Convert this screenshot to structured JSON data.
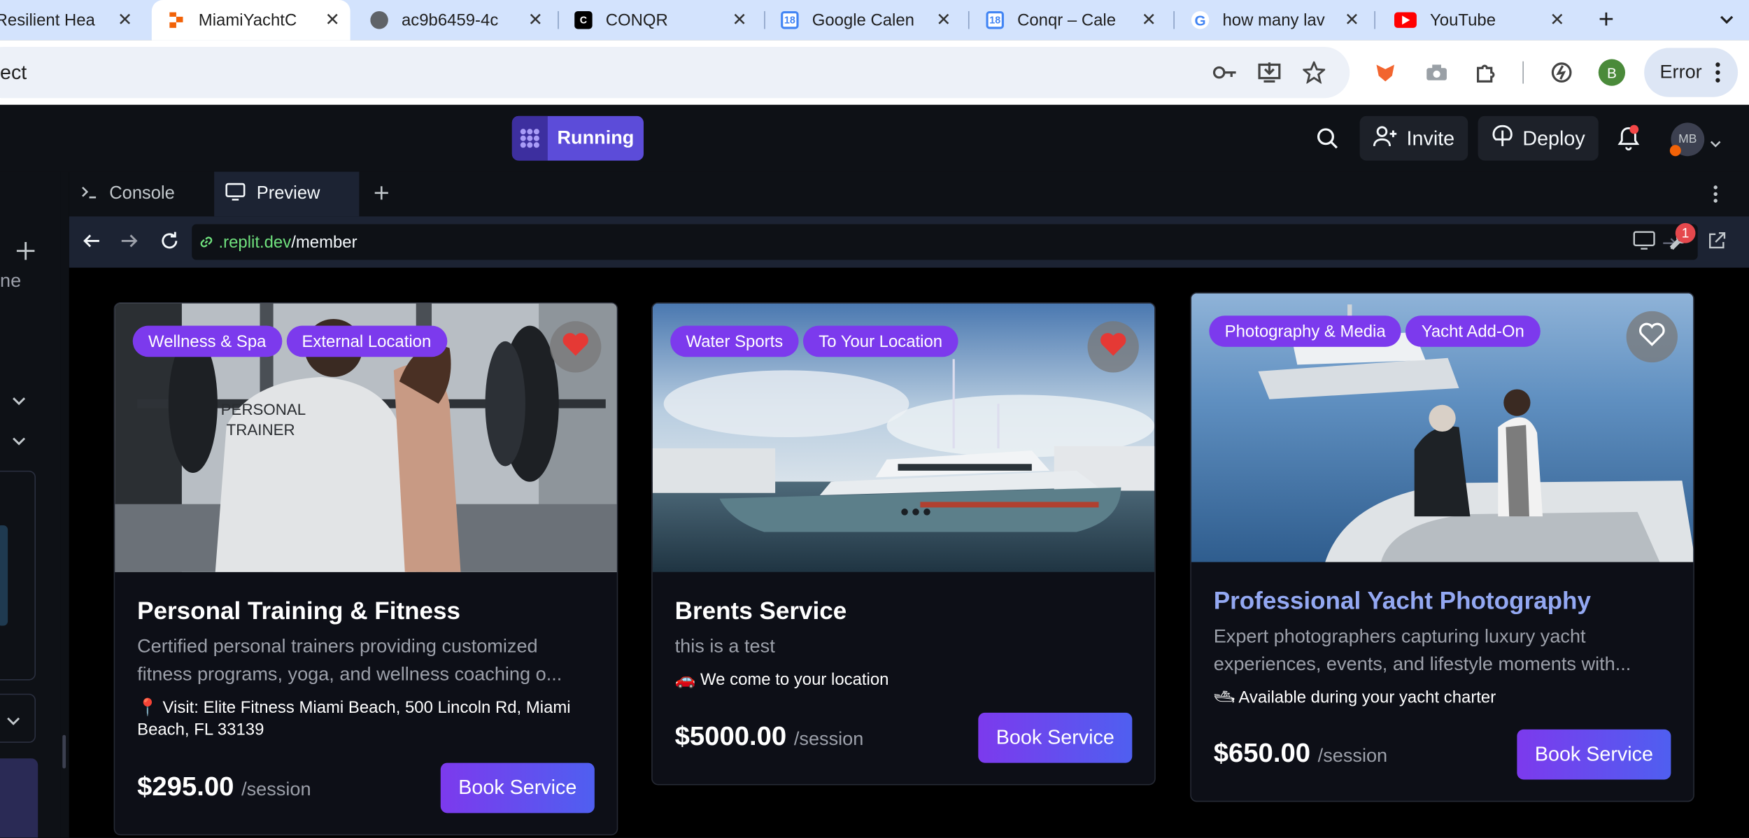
{
  "browser": {
    "tabs": [
      {
        "title": "Resilient Hea",
        "favicon_color": "#c7d3e8"
      },
      {
        "title": "MiamiYachtC",
        "favicon_color": "#f26207"
      },
      {
        "title": "ac9b6459-4c",
        "favicon_color": "#5f6368"
      },
      {
        "title": "CONQR",
        "favicon_color": "#000000",
        "favicon_text": "C"
      },
      {
        "title": "Google Calen",
        "favicon_color": "#4285f4",
        "favicon_text": "18"
      },
      {
        "title": "Conqr – Cale",
        "favicon_color": "#4285f4",
        "favicon_text": "18"
      },
      {
        "title": "how many lav",
        "favicon_color": "#ffffff",
        "favicon_text": "G"
      },
      {
        "title": "YouTube",
        "favicon_color": "#ff0000"
      }
    ],
    "close_glyph": "✕",
    "new_tab_glyph": "+",
    "address_text": "ect",
    "error_label": "Error",
    "profile_initial": "B"
  },
  "replit": {
    "run_label": "Running",
    "invite_label": "Invite",
    "deploy_label": "Deploy",
    "avatar_initials": "MB",
    "panel_tabs": [
      {
        "label": "Console",
        "icon": "terminal-icon"
      },
      {
        "label": "Preview",
        "icon": "monitor-icon"
      }
    ],
    "url_host": ".replit.dev",
    "url_path": "/member",
    "devtools_badge": "1",
    "sidebar_partial_text": "ne"
  },
  "cards": [
    {
      "badges": [
        "Wellness & Spa",
        "External Location"
      ],
      "favorited": true,
      "title": "Personal Training & Fitness",
      "description": "Certified personal trainers providing customized fitness programs, yoga, and wellness coaching o...",
      "location": "📍 Visit: Elite Fitness Miami Beach, 500 Lincoln Rd, Miami Beach, FL 33139",
      "price": "$295.00",
      "unit": "/session",
      "button": "Book Service",
      "image_text": [
        "PERSONAL",
        "TRAINER"
      ]
    },
    {
      "badges": [
        "Water Sports",
        "To Your Location"
      ],
      "favorited": true,
      "title": "Brents Service",
      "description": "this is a test",
      "location": "🚗 We come to your location",
      "price": "$5000.00",
      "unit": "/session",
      "button": "Book Service"
    },
    {
      "badges": [
        "Photography & Media",
        "Yacht Add-On"
      ],
      "favorited": false,
      "title": "Professional Yacht Photography",
      "description": "Expert photographers capturing luxury yacht experiences, events, and lifestyle moments with...",
      "location": "🛥 Available during your yacht charter",
      "price": "$650.00",
      "unit": "/session",
      "button": "Book Service"
    }
  ]
}
